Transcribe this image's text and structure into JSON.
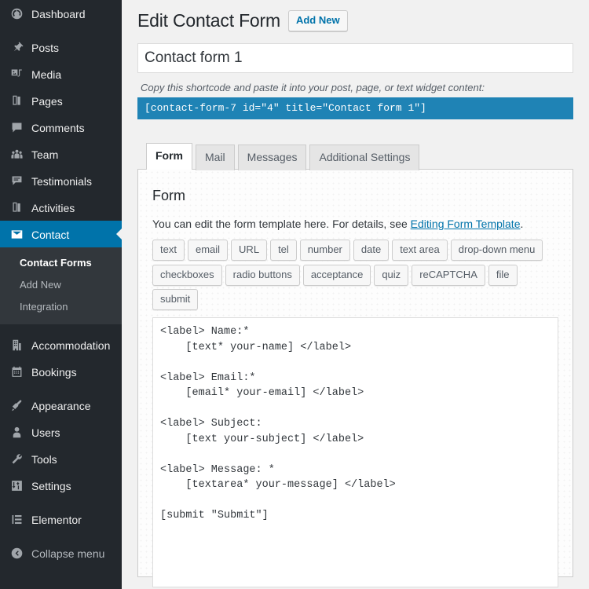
{
  "sidebar": {
    "items": [
      {
        "label": "Dashboard",
        "icon": "dashboard-icon",
        "name": "dashboard"
      },
      {
        "label": "Posts",
        "icon": "pin-icon",
        "name": "posts"
      },
      {
        "label": "Media",
        "icon": "media-icon",
        "name": "media"
      },
      {
        "label": "Pages",
        "icon": "pages-icon",
        "name": "pages"
      },
      {
        "label": "Comments",
        "icon": "comment-icon",
        "name": "comments"
      },
      {
        "label": "Team",
        "icon": "team-icon",
        "name": "team"
      },
      {
        "label": "Testimonials",
        "icon": "testimonials-icon",
        "name": "testimonials"
      },
      {
        "label": "Activities",
        "icon": "activities-icon",
        "name": "activities"
      },
      {
        "label": "Contact",
        "icon": "envelope-icon",
        "name": "contact",
        "active": true
      }
    ],
    "submenu": [
      {
        "label": "Contact Forms",
        "current": true
      },
      {
        "label": "Add New",
        "current": false
      },
      {
        "label": "Integration",
        "current": false
      }
    ],
    "items_lower": [
      {
        "label": "Accommodation",
        "icon": "building-icon",
        "name": "accommodation"
      },
      {
        "label": "Bookings",
        "icon": "calendar-icon",
        "name": "bookings"
      }
    ],
    "items_admin": [
      {
        "label": "Appearance",
        "icon": "brush-icon",
        "name": "appearance"
      },
      {
        "label": "Users",
        "icon": "user-icon",
        "name": "users"
      },
      {
        "label": "Tools",
        "icon": "wrench-icon",
        "name": "tools"
      },
      {
        "label": "Settings",
        "icon": "sliders-icon",
        "name": "settings"
      }
    ],
    "items_last": [
      {
        "label": "Elementor",
        "icon": "elementor-icon",
        "name": "elementor"
      }
    ],
    "collapse": {
      "label": "Collapse menu",
      "icon": "collapse-arrow-icon"
    },
    "colors": {
      "background": "#23282d",
      "submenu_background": "#32373c",
      "active": "#0073aa"
    }
  },
  "header": {
    "title": "Edit Contact Form",
    "add_new_label": "Add New"
  },
  "form_title": {
    "value": "Contact form 1",
    "placeholder": "Enter title here"
  },
  "shortcode": {
    "note": "Copy this shortcode and paste it into your post, page, or text widget content:",
    "value": "[contact-form-7 id=\"4\" title=\"Contact form 1\"]",
    "color": "#1f83b5"
  },
  "tabs": [
    {
      "label": "Form",
      "active": true
    },
    {
      "label": "Mail",
      "active": false
    },
    {
      "label": "Messages",
      "active": false
    },
    {
      "label": "Additional Settings",
      "active": false
    }
  ],
  "panel": {
    "heading": "Form",
    "description_before": "You can edit the form template here. For details, see ",
    "description_link": "Editing Form Template",
    "description_after": ".",
    "tag_rows": [
      [
        "text",
        "email",
        "URL",
        "tel",
        "number",
        "date",
        "text area",
        "drop-down menu"
      ],
      [
        "checkboxes",
        "radio buttons",
        "acceptance",
        "quiz",
        "reCAPTCHA",
        "file",
        "submit"
      ]
    ],
    "code": "<label> Name:*\n    [text* your-name] </label>\n\n<label> Email:*\n    [email* your-email] </label>\n\n<label> Subject:\n    [text your-subject] </label>\n\n<label> Message: *\n    [textarea* your-message] </label>\n\n[submit \"Submit\"]"
  }
}
